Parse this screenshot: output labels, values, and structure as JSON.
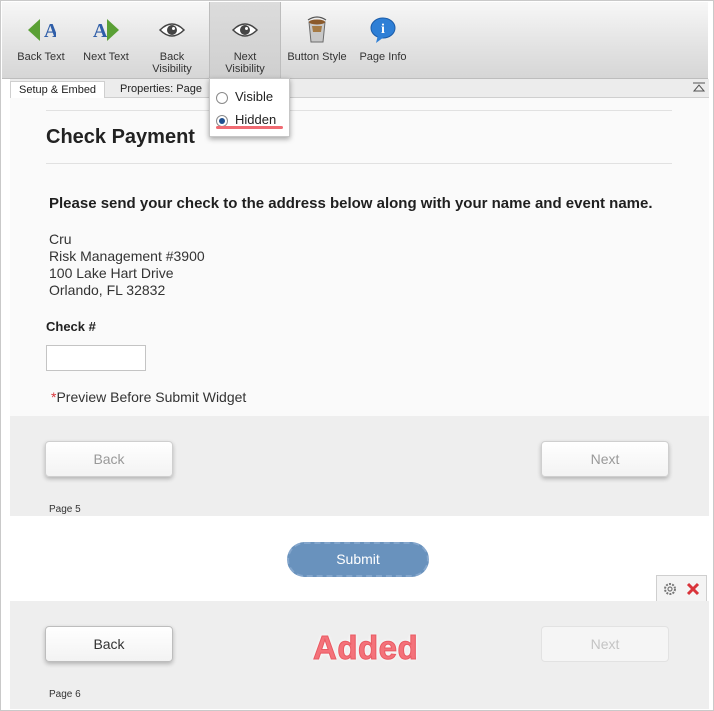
{
  "toolbar": {
    "back_text": "Back Text",
    "next_text": "Next Text",
    "back_visibility": "Back\nVisibility",
    "next_visibility": "Next\nVisibility",
    "button_style": "Button Style",
    "page_info": "Page Info"
  },
  "tabs": {
    "setup_embed": "Setup & Embed",
    "properties": "Properties: Page"
  },
  "visibility_dropdown": {
    "options": [
      "Visible",
      "Hidden"
    ],
    "selected": "Hidden"
  },
  "form": {
    "title": "Check Payment",
    "instructions": "Please send your check to the address below along with your name and event name.",
    "address": [
      "Cru",
      "Risk Management #3900",
      "100 Lake Hart Drive",
      "Orlando, FL 32832"
    ],
    "check_label": "Check #",
    "check_value": "",
    "preview_star": "*",
    "preview_text": "Preview Before Submit Widget"
  },
  "page5": {
    "back_label": "Back",
    "next_label": "Next",
    "page_label": "Page 5"
  },
  "submit_label": "Submit",
  "page6": {
    "back_label": "Back",
    "next_label": "Next",
    "page_label": "Page 6"
  },
  "annotation": "Added",
  "icons": {
    "back_text": "back-text-icon",
    "next_text": "next-text-icon",
    "back_visibility": "eye-icon",
    "next_visibility": "eye-icon",
    "button_style": "paint-bucket-icon",
    "page_info": "info-bubble-icon",
    "collapse": "collapse-triangle-icon",
    "settings": "gear-icon",
    "remove": "close-icon"
  },
  "colors": {
    "submit": "#6992bd",
    "annotation": "#f4727a",
    "highlight_underline": "#f06a72",
    "delete": "#d9343a"
  }
}
